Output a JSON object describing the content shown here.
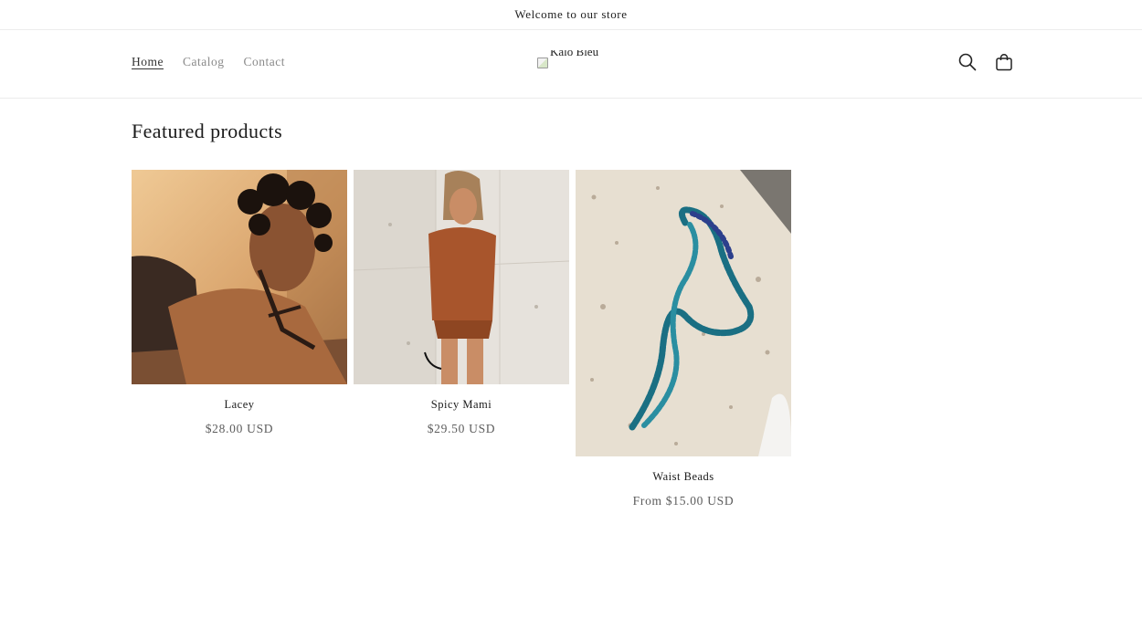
{
  "announcement": {
    "text": "Welcome to our store"
  },
  "header": {
    "nav": [
      {
        "label": "Home",
        "active": true
      },
      {
        "label": "Catalog",
        "active": false
      },
      {
        "label": "Contact",
        "active": false
      }
    ],
    "logo_alt": "Kalo Bleu",
    "icons": [
      "search-icon",
      "cart-icon"
    ]
  },
  "featured": {
    "title": "Featured products",
    "products": [
      {
        "title": "Lacey",
        "price": "$28.00 USD"
      },
      {
        "title": "Spicy Mami",
        "price": "$29.50 USD"
      },
      {
        "title": "Waist Beads",
        "price": "From $15.00 USD"
      }
    ]
  }
}
